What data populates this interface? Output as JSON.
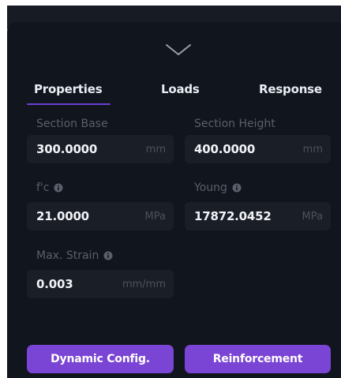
{
  "colors": {
    "panel_bg": "#11151d",
    "field_bg": "#1a1e27",
    "accent": "#6b3fd1",
    "button_bg": "#7a44d4",
    "label_text": "#5a5f6b",
    "value_text": "#f1f3f7"
  },
  "header": {
    "collapse_icon": "chevron-down-icon"
  },
  "tabs": [
    {
      "label": "Properties",
      "active": true
    },
    {
      "label": "Loads",
      "active": false
    },
    {
      "label": "Response",
      "active": false
    }
  ],
  "fields": {
    "section_base": {
      "label": "Section Base",
      "value": "300.0000",
      "unit": "mm"
    },
    "section_height": {
      "label": "Section Height",
      "value": "400.0000",
      "unit": "mm"
    },
    "fc": {
      "label": "f'c",
      "value": "21.0000",
      "unit": "MPa",
      "icon": "info-icon"
    },
    "young": {
      "label": "Young",
      "value": "17872.0452",
      "unit": "MPa",
      "icon": "info-icon"
    },
    "max_strain": {
      "label": "Max. Strain",
      "value": "0.003",
      "unit": "mm/mm",
      "icon": "info-icon"
    }
  },
  "buttons": {
    "dynamic_config": "Dynamic Config.",
    "reinforcement": "Reinforcement"
  }
}
